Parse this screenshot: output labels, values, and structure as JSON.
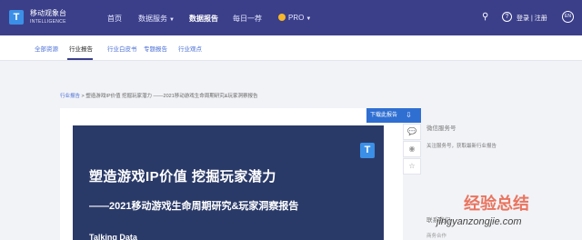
{
  "header": {
    "logo_letter": "T",
    "app_name": "移动观象台",
    "app_sub": "INTELLIGENCE",
    "nav": [
      {
        "label": "首页"
      },
      {
        "label": "数据服务"
      },
      {
        "label": "数据报告"
      },
      {
        "label": "每日一荐"
      },
      {
        "label": "PRO"
      }
    ],
    "login_label": "登录 | 注册",
    "lang_label": "EN"
  },
  "subnav": {
    "items": [
      {
        "label": "全部资源"
      },
      {
        "label": "行业报告"
      },
      {
        "label": "行业白皮书"
      },
      {
        "label": "专题报告"
      },
      {
        "label": "行业观点"
      }
    ]
  },
  "breadcrumb": {
    "link": "行业报告",
    "sep": " > ",
    "current": "塑造游戏IP价值 挖掘玩家潜力 ——2021移动游戏生命周期研究&玩家洞察报告"
  },
  "report": {
    "download_label": "下载此报告",
    "cover_logo": "T",
    "title": "塑造游戏IP价值   挖掘玩家潜力",
    "subtitle": "——2021移动游戏生命周期研究&玩家洞察报告",
    "next_line": "Talking Data"
  },
  "sidebar": {
    "title": "微信服务号",
    "desc": "关注服务号，获取最新行业报告",
    "contact": "联系我们",
    "row": "商务合作"
  },
  "watermark": {
    "text": "经验总结",
    "url": "jingyanzongjie.com"
  }
}
